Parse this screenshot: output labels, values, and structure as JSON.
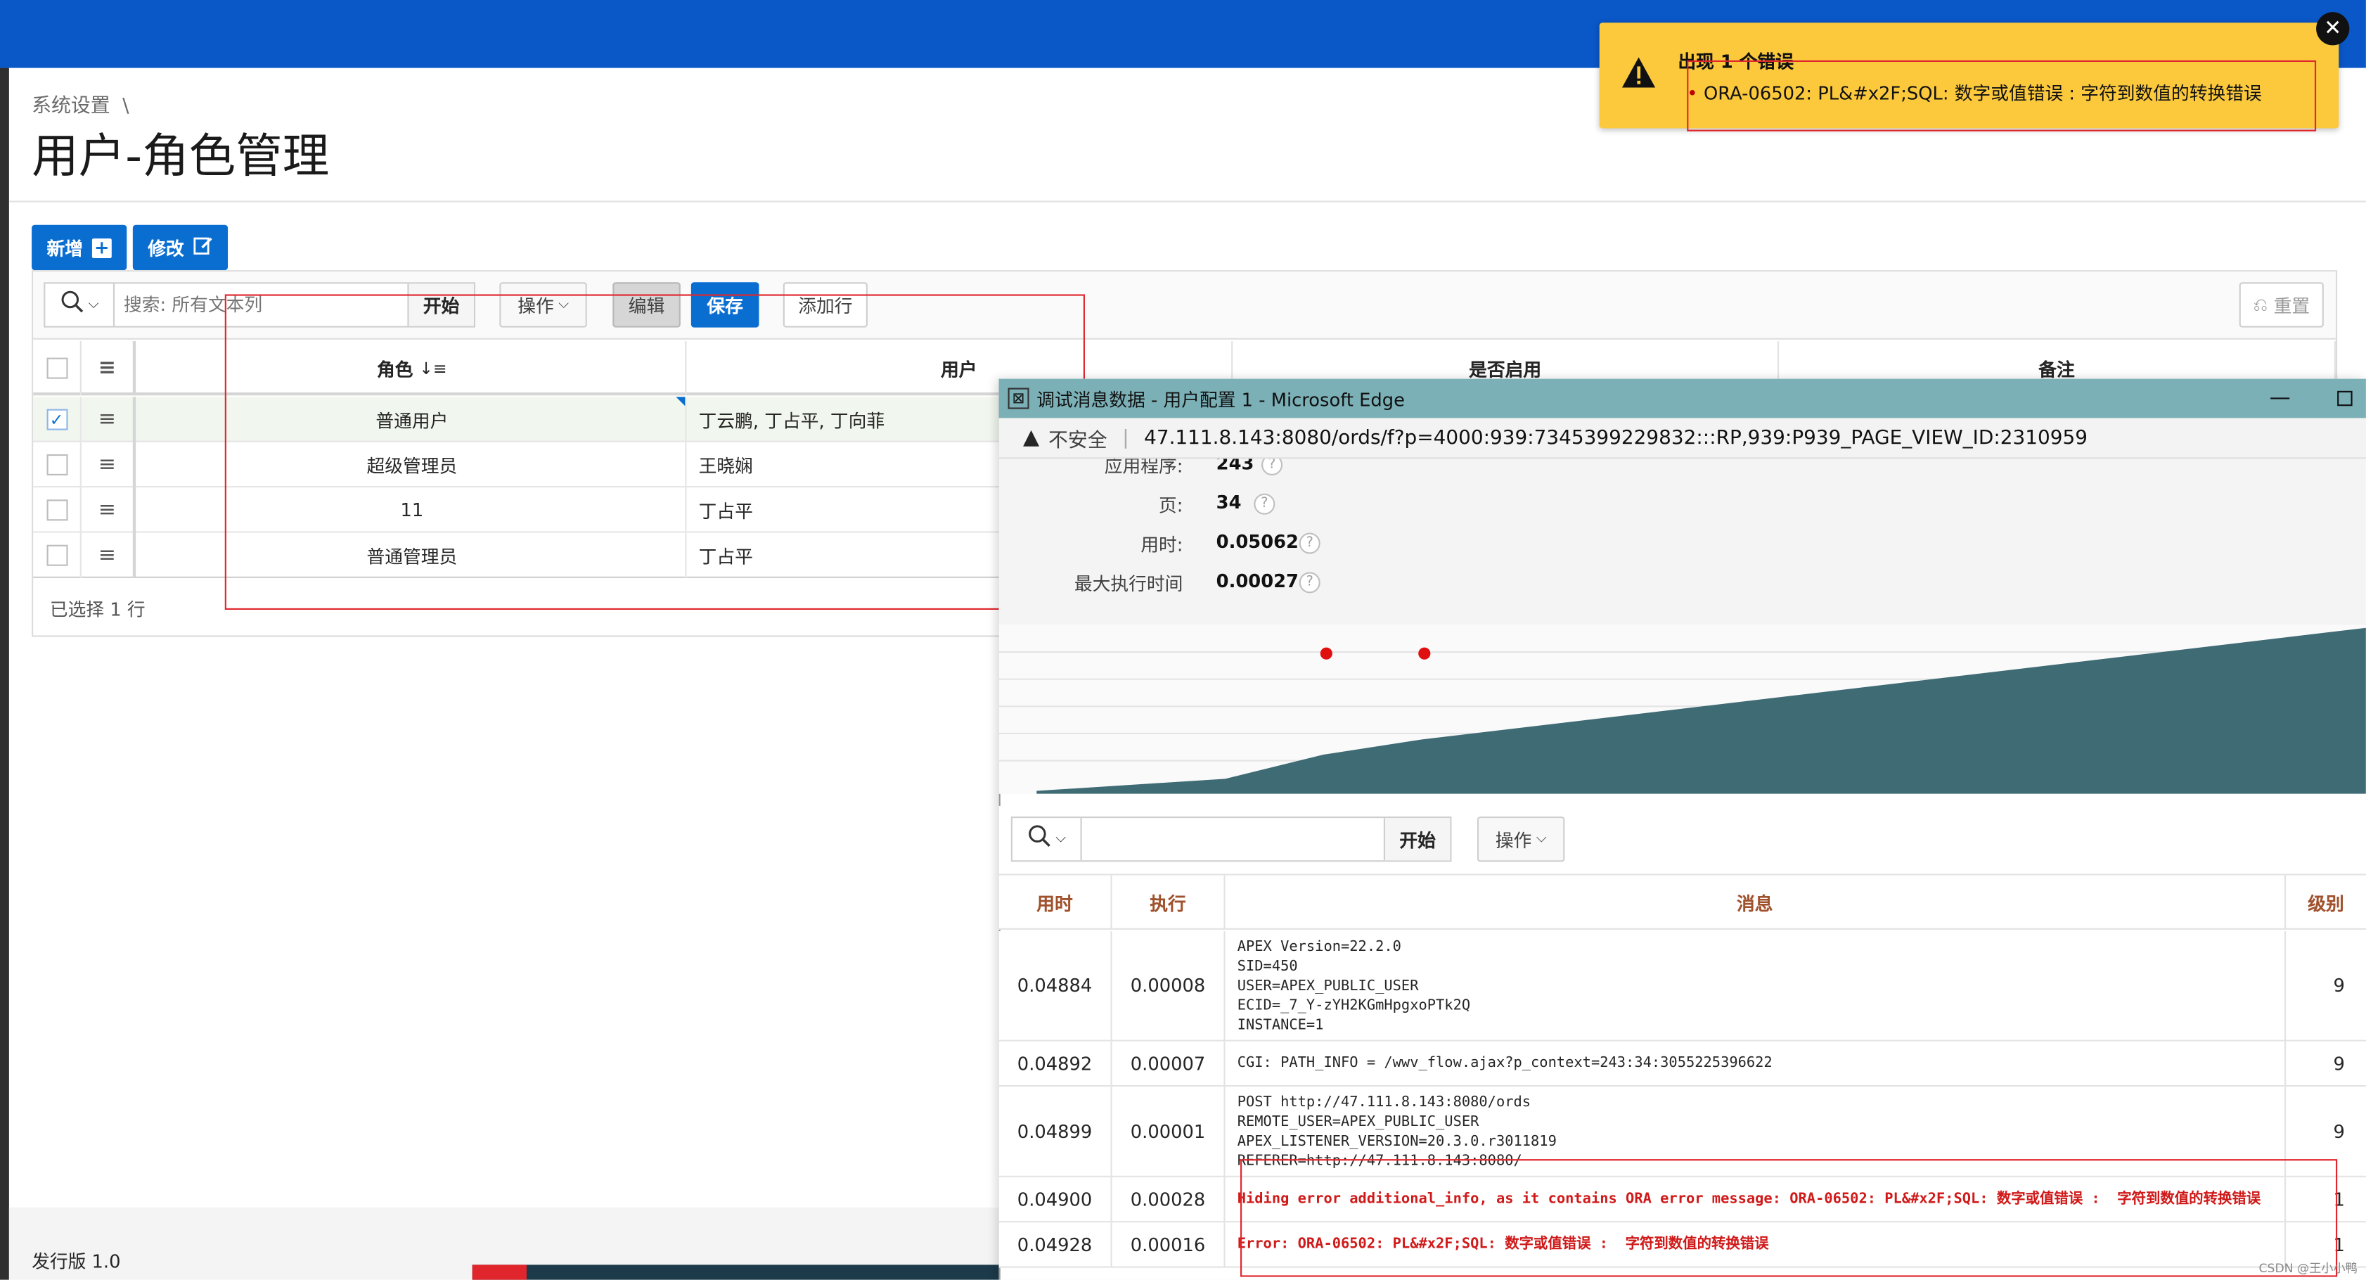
{
  "breadcrumb": {
    "parent": "系统设置",
    "separator": "\\"
  },
  "page_title": "用户-角色管理",
  "actions": {
    "add_label": "新增",
    "edit_label": "修改"
  },
  "grid_toolbar": {
    "search_placeholder": "搜索: 所有文本列",
    "go_label": "开始",
    "actions_label": "操作",
    "edit_label": "编辑",
    "save_label": "保存",
    "add_row_label": "添加行",
    "reset_label": "重置"
  },
  "grid": {
    "columns": [
      "角色",
      "用户",
      "是否启用",
      "备注"
    ],
    "sort_indicator": "↓≡",
    "rows": [
      {
        "role": "普通用户",
        "users": "丁云鹏, 丁占平, 丁向菲",
        "checked": true
      },
      {
        "role": "超级管理员",
        "users": "王晓娴",
        "checked": false
      },
      {
        "role": "11",
        "users": "丁占平",
        "checked": false
      },
      {
        "role": "普通管理员",
        "users": "丁占平",
        "checked": false
      }
    ],
    "selection_status": "已选择 1 行"
  },
  "footer": {
    "version": "发行版 1.0"
  },
  "error_toast": {
    "title": "出现 1 个错误",
    "message": "ORA-06502: PL&#x2F;SQL: 数字或值错误 : 字符到数值的转换错误",
    "close_label": "✕"
  },
  "debug_window": {
    "title": "调试消息数据 - 用户配置 1 - Microsoft Edge",
    "security_label": "不安全",
    "url": "47.111.8.143:8080/ords/f?p=4000:939:7345399229832:::RP,939:P939_PAGE_VIEW_ID:2310959",
    "info": [
      {
        "label": "应用程序:",
        "value": "243"
      },
      {
        "label": "页:",
        "value": "34"
      },
      {
        "label": "用时:",
        "value": "0.05062"
      },
      {
        "label": "最大执行时间",
        "value": "0.00027"
      }
    ],
    "toolbar": {
      "go_label": "开始",
      "actions_label": "操作"
    },
    "columns": [
      "用时",
      "执行",
      "消息",
      "级别"
    ],
    "rows": [
      {
        "elapsed": "0.04884",
        "exec": "0.00008",
        "message": "APEX Version=22.2.0\nSID=450\nUSER=APEX_PUBLIC_USER\nECID=_7_Y-zYH2KGmHpgxoPTk2Q\nINSTANCE=1",
        "level": "9",
        "error": false
      },
      {
        "elapsed": "0.04892",
        "exec": "0.00007",
        "message": "CGI: PATH_INFO = /wwv_flow.ajax?p_context=243:34:3055225396622",
        "level": "9",
        "error": false
      },
      {
        "elapsed": "0.04899",
        "exec": "0.00001",
        "message": "POST http://47.111.8.143:8080/ords\nREMOTE_USER=APEX_PUBLIC_USER\nAPEX_LISTENER_VERSION=20.3.0.r3011819\nREFERER=http://47.111.8.143:8080/",
        "level": "9",
        "error": false
      },
      {
        "elapsed": "0.04900",
        "exec": "0.00028",
        "message": "Hiding error additional_info, as it contains ORA error message: ORA-06502: PL&#x2F;SQL: 数字或值错误 :  字符到数值的转换错误",
        "level": "1",
        "error": true
      },
      {
        "elapsed": "0.04928",
        "exec": "0.00016",
        "message": "Error: ORA-06502: PL&#x2F;SQL: 数字或值错误 :  字符到数值的转换错误",
        "level": "1",
        "error": true
      }
    ]
  },
  "watermark": "CSDN @王小小鸭",
  "colors": {
    "topbar": "#0a57c8",
    "primary": "#0a6ed1",
    "toast": "#fcc93d",
    "annotation": "#e0262c",
    "debug_title": "#7bb0b7",
    "area_fill": "#3f6b75"
  }
}
